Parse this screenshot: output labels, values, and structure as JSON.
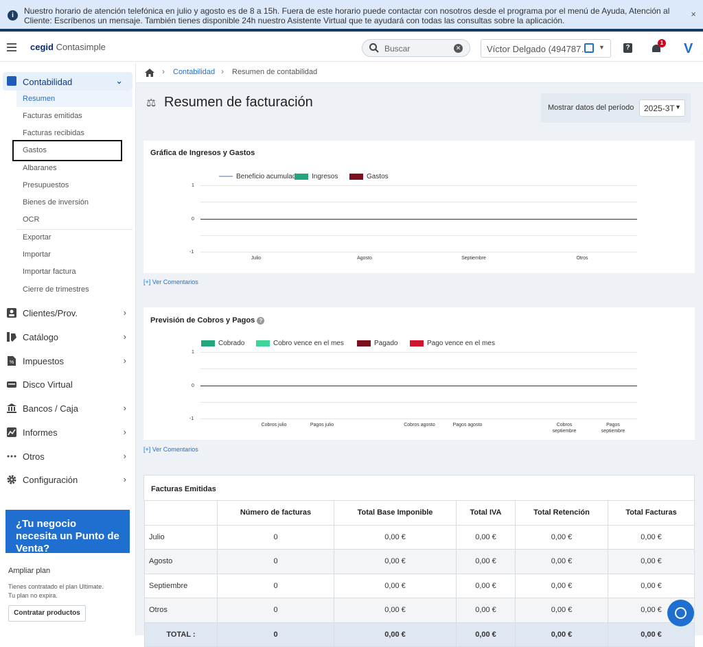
{
  "banner": {
    "text": "Nuestro horario de atención telefónica en julio y agosto es de 8 a 15h. Fuera de este horario puede contactar con nosotros desde el programa por el menú de Ayuda, Atención al Cliente: Escríbenos un mensaje. También tienes disponible 24h nuestro Asistente Virtual que te ayudará con todas las consultas sobre la aplicación.",
    "close": "×",
    "info_icon": "i"
  },
  "topbar": {
    "logo_brand": "cegid",
    "logo_product": "Contasimple",
    "search_placeholder": "Buscar",
    "user": "Víctor Delgado (494787…",
    "notif_count": "1",
    "help": "?",
    "logo_v": "V"
  },
  "sidebar": {
    "contabilidad": "Contabilidad",
    "sub": [
      "Resumen",
      "Facturas emitidas",
      "Facturas recibidas",
      "Gastos",
      "Albaranes",
      "Presupuestos",
      "Bienes de inversión",
      "OCR",
      "Exportar",
      "Importar",
      "Importar factura",
      "Cierre de trimestres"
    ],
    "sections": [
      "Clientes/Prov.",
      "Catálogo",
      "Impuestos",
      "Disco Virtual",
      "Bancos / Caja",
      "Informes",
      "Otros",
      "Configuración"
    ],
    "promo": "¿Tu negocio necesita un Punto de Venta?",
    "plan_title": "Ampliar plan",
    "plan_text_1": "Tienes contratado el plan Ultimate.",
    "plan_text_2": "Tu plan no expira.",
    "plan_button": "Contratar productos"
  },
  "breadcrumb": {
    "c1": "Contabilidad",
    "c2": "Resumen de contabilidad"
  },
  "page": {
    "title": "Resumen de facturación",
    "period_label": "Mostrar datos del período",
    "period_value": "2025-3T"
  },
  "chart1": {
    "title": "Gráfica de Ingresos y Gastos",
    "legend": [
      "Beneficio acumulado",
      "Ingresos",
      "Gastos"
    ],
    "colors": [
      "#a8b8d0",
      "#22a67e",
      "#7a0f1e"
    ],
    "yticks": [
      "1",
      "0",
      "-1"
    ],
    "xlabels": [
      "Julio",
      "Agosto",
      "Septiembre",
      "Otros"
    ],
    "comments": "[+] Ver Comentarios"
  },
  "chart2": {
    "title": "Previsión de Cobros y Pagos",
    "legend": [
      "Cobrado",
      "Cobro vence en el mes",
      "Pagado",
      "Pago vence en el mes"
    ],
    "colors": [
      "#22a67e",
      "#3fd39c",
      "#7a0f1e",
      "#d0142c"
    ],
    "yticks": [
      "1",
      "0",
      "-1"
    ],
    "xlabels": [
      "Cobros julio",
      "Pagos julio",
      "Cobros agosto",
      "Pagos agosto",
      "Cobros septiembre",
      "Pagos septiembre"
    ],
    "comments": "[+] Ver Comentarios"
  },
  "chart_data": [
    {
      "type": "bar",
      "categories": [
        "Julio",
        "Agosto",
        "Septiembre",
        "Otros"
      ],
      "series": [
        {
          "name": "Beneficio acumulado",
          "values": [
            0,
            0,
            0,
            0
          ]
        },
        {
          "name": "Ingresos",
          "values": [
            0,
            0,
            0,
            0
          ]
        },
        {
          "name": "Gastos",
          "values": [
            0,
            0,
            0,
            0
          ]
        }
      ],
      "title": "Gráfica de Ingresos y Gastos",
      "ylim": [
        -1,
        1
      ]
    },
    {
      "type": "bar",
      "categories": [
        "Cobros julio",
        "Pagos julio",
        "Cobros agosto",
        "Pagos agosto",
        "Cobros septiembre",
        "Pagos septiembre"
      ],
      "series": [
        {
          "name": "Cobrado",
          "values": [
            0,
            0,
            0,
            0,
            0,
            0
          ]
        },
        {
          "name": "Cobro vence en el mes",
          "values": [
            0,
            0,
            0,
            0,
            0,
            0
          ]
        },
        {
          "name": "Pagado",
          "values": [
            0,
            0,
            0,
            0,
            0,
            0
          ]
        },
        {
          "name": "Pago vence en el mes",
          "values": [
            0,
            0,
            0,
            0,
            0,
            0
          ]
        }
      ],
      "title": "Previsión de Cobros y Pagos",
      "ylim": [
        -1,
        1
      ]
    }
  ],
  "table": {
    "title": "Facturas Emitidas",
    "headers": [
      "",
      "Número de facturas",
      "Total Base Imponible",
      "Total IVA",
      "Total Retención",
      "Total Facturas"
    ],
    "rows": [
      [
        "Julio",
        "0",
        "0,00 €",
        "0,00 €",
        "0,00 €",
        "0,00 €"
      ],
      [
        "Agosto",
        "0",
        "0,00 €",
        "0,00 €",
        "0,00 €",
        "0,00 €"
      ],
      [
        "Septiembre",
        "0",
        "0,00 €",
        "0,00 €",
        "0,00 €",
        "0,00 €"
      ],
      [
        "Otros",
        "0",
        "0,00 €",
        "0,00 €",
        "0,00 €",
        "0,00 €"
      ],
      [
        "TOTAL :",
        "0",
        "0,00 €",
        "0,00 €",
        "0,00 €",
        "0,00 €"
      ]
    ]
  }
}
